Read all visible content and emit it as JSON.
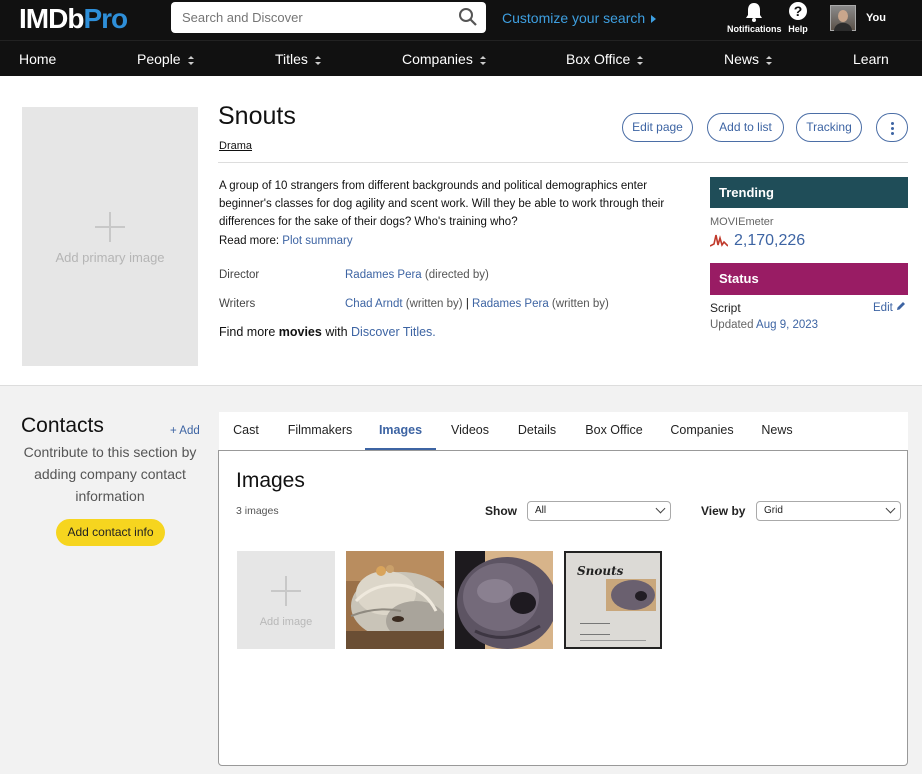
{
  "header": {
    "logo_main": "IMDb",
    "logo_pro": "Pro",
    "search_placeholder": "Search and Discover",
    "customize": "Customize your search",
    "notifications": "Notifications",
    "help": "Help",
    "user": "You"
  },
  "nav": [
    "Home",
    "People",
    "Titles",
    "Companies",
    "Box Office",
    "News",
    "Learn"
  ],
  "title": {
    "name": "Snouts",
    "genre": "Drama",
    "actions": [
      "Edit page",
      "Add to list",
      "Tracking"
    ],
    "primary_image_label": "Add primary image",
    "summary": "A group of 10 strangers from different backgrounds and political demographics enter beginner's classes for dog agility and scent work. Will they be able to work through their differences for the sake of their dogs? Who's training who?",
    "read_more_label": "Read more:",
    "read_more_link": "Plot summary",
    "director_label": "Director",
    "director_name": "Radames Pera",
    "director_note": " (directed by)",
    "writers_label": "Writers",
    "writer1_name": "Chad Arndt",
    "writer1_note": " (written by)",
    "writer_sep": " | ",
    "writer2_name": "Radames Pera",
    "writer2_note": " (written by)",
    "find_prefix": "Find more ",
    "find_bold": "movies",
    "find_mid": " with ",
    "find_link": "Discover Titles."
  },
  "trending": {
    "heading": "Trending",
    "meter_label": "MOVIEmeter",
    "meter_value": "2,170,226"
  },
  "status": {
    "heading": "Status",
    "value": "Script",
    "edit": "Edit",
    "updated_prefix": "Updated ",
    "updated_date": "Aug 9, 2023"
  },
  "contacts": {
    "heading": "Contacts",
    "add": "+ Add",
    "text": "Contribute to this section by adding company contact information",
    "button": "Add contact info"
  },
  "tabs": [
    "Cast",
    "Filmmakers",
    "Images",
    "Videos",
    "Details",
    "Box Office",
    "Companies",
    "News"
  ],
  "active_tab": "Images",
  "images_panel": {
    "heading": "Images",
    "count": "3 images",
    "show_label": "Show",
    "show_value": "All",
    "view_label": "View by",
    "view_value": "Grid",
    "add_image_label": "Add image",
    "poster_title": "Snouts"
  },
  "colors": {
    "brand_blue": "#2e8fd9",
    "link": "#3d64a3",
    "trending": "#1f4d58",
    "status": "#991c64",
    "contact_button": "#f6d51f"
  }
}
